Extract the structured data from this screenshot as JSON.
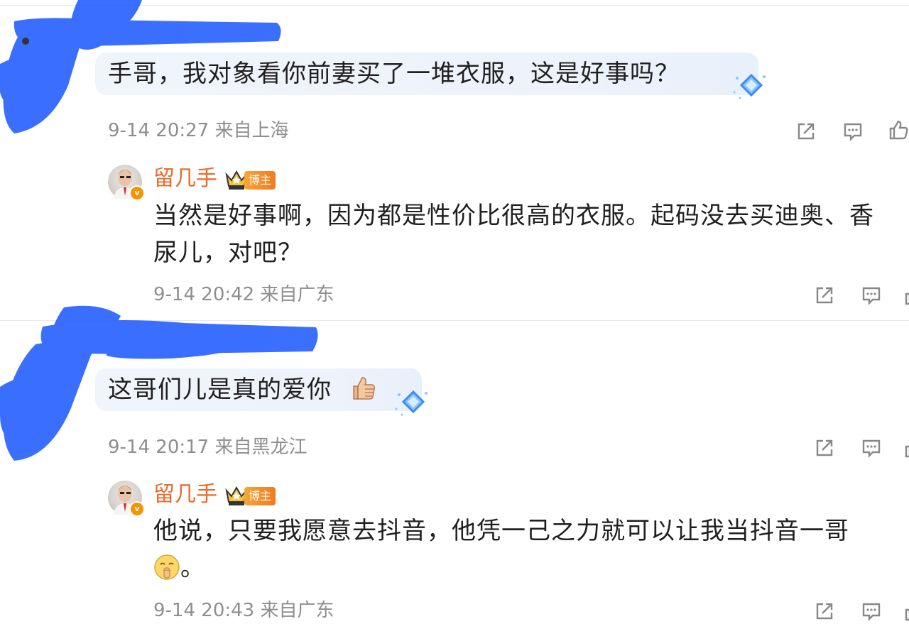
{
  "threads": [
    {
      "comment": {
        "text": "手哥，我对象看你前妻买了一堆衣服，这是好事吗？",
        "time": "9-14 20:27",
        "location": "来自上海"
      },
      "reply": {
        "author": "留几手",
        "badge": "博主",
        "line1": "当然是好事啊，因为都是性价比很高的衣服。起码没去买迪奥、香",
        "line2": "尿儿，对吧？",
        "time": "9-14 20:42",
        "location": "来自广东"
      }
    },
    {
      "comment": {
        "text": "这哥们儿是真的爱你",
        "time": "9-14 20:17",
        "location": "来自黑龙江"
      },
      "reply": {
        "author": "留几手",
        "badge": "博主",
        "line1": "他说，只要我愿意去抖音，他凭一己之力就可以让我当抖音一哥",
        "line2": "。",
        "time": "9-14 20:43",
        "location": "来自广东"
      }
    }
  ],
  "icons": {
    "share": "share-icon",
    "comment": "comment-icon",
    "like": "like-icon",
    "crown": "crown-icon",
    "thumbs_up_emoji": "thumbs-up-emoji",
    "shush_emoji": "shush-emoji",
    "gem": "diamond-icon"
  },
  "colors": {
    "author": "#e86b2c",
    "meta": "#8e8e8e",
    "badge": "#ef7b22",
    "bubble": "#eef3fb",
    "redaction": "#1f5bff"
  }
}
